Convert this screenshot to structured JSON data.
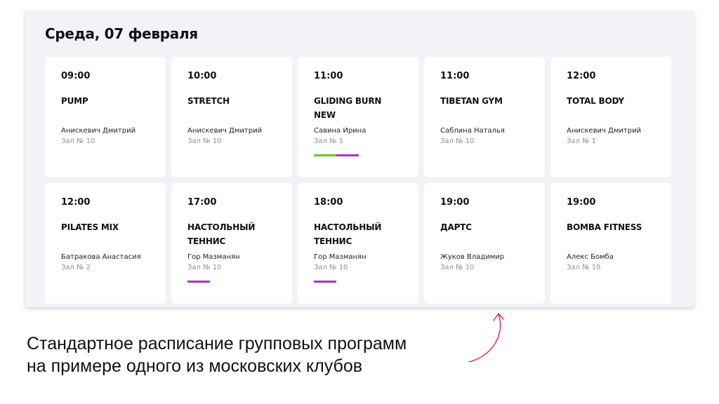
{
  "schedule": {
    "day_title": "Среда, 07 февраля",
    "classes": [
      {
        "time": "09:00",
        "name": "PUMP",
        "trainer": "Анискевич Дмитрий",
        "hall": "Зал № 10",
        "tags": []
      },
      {
        "time": "10:00",
        "name": "STRETCH",
        "trainer": "Анискевич Дмитрий",
        "hall": "Зал № 10",
        "tags": []
      },
      {
        "time": "11:00",
        "name": "GLIDING BURN NEW",
        "trainer": "Савина Ирина",
        "hall": "Зал № 1",
        "tags": [
          "#5fcf2f",
          "#b329d9"
        ]
      },
      {
        "time": "11:00",
        "name": "TIBETAN GYM",
        "trainer": "Саблина Наталья",
        "hall": "Зал № 10",
        "tags": []
      },
      {
        "time": "12:00",
        "name": "TOTAL BODY",
        "trainer": "Анискевич Дмитрий",
        "hall": "Зал № 1",
        "tags": []
      },
      {
        "time": "12:00",
        "name": "PILATES MIX",
        "trainer": "Батракова Анастасия",
        "hall": "Зал № 2",
        "tags": []
      },
      {
        "time": "17:00",
        "name": "НАСТОЛЬНЫЙ ТЕННИС",
        "trainer": "Гор Мазманян",
        "hall": "Зал № 10",
        "tags": [
          "#b329d9"
        ]
      },
      {
        "time": "18:00",
        "name": "НАСТОЛЬНЫЙ ТЕННИС",
        "trainer": "Гор Мазманян",
        "hall": "Зал № 10",
        "tags": [
          "#b329d9"
        ]
      },
      {
        "time": "19:00",
        "name": "ДАРТС",
        "trainer": "Жуков Владимир",
        "hall": "Зал № 10",
        "tags": []
      },
      {
        "time": "19:00",
        "name": "BOMBA FITNESS",
        "trainer": "Алекс Бомба",
        "hall": "Зал № 10",
        "tags": []
      }
    ]
  },
  "caption": {
    "line1": "Стандартное расписание групповых программ",
    "line2": "на примере одного из московских клубов"
  },
  "colors": {
    "panel_bg": "#f2f3f7",
    "card_bg": "#ffffff",
    "arrow": "#e0245e",
    "tag_green": "#5fcf2f",
    "tag_purple": "#b329d9"
  },
  "icons": {
    "arrow": "curved-arrow-icon"
  }
}
